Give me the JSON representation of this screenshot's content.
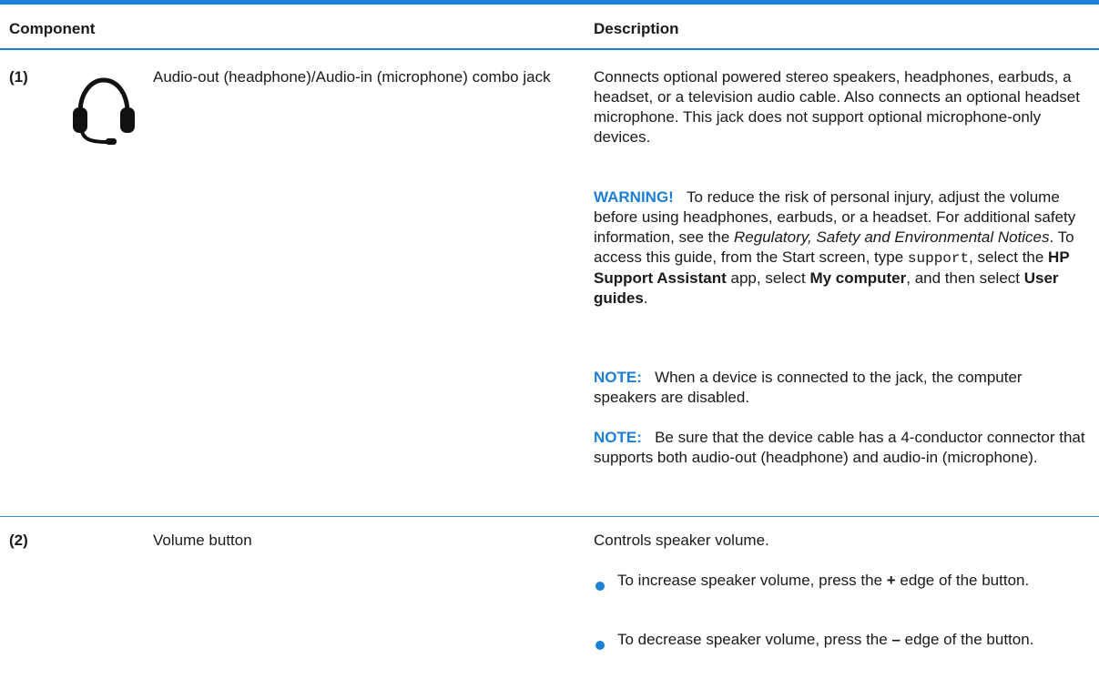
{
  "header": {
    "component": "Component",
    "description": "Description"
  },
  "rows": [
    {
      "number": "(1)",
      "icon": "headset-icon",
      "component": "Audio-out (headphone)/Audio-in (microphone) combo jack",
      "description": "Connects optional powered stereo speakers, headphones, earbuds, a headset, or a television audio cable. Also connects an optional headset microphone. This jack does not support optional microphone-only devices.",
      "warning": {
        "label": "WARNING!",
        "text1": "To reduce the risk of personal injury, adjust the volume before using headphones, earbuds, or a headset. For additional safety information, see the ",
        "doc_title": "Regulatory, Safety and Environmental Notices",
        "text2": ". To access this guide, from the Start screen, type ",
        "code": "support",
        "text3": ", select the ",
        "app": "HP Support Assistant",
        "text4": " app, select ",
        "my_computer": "My computer",
        "text5": ", and then select ",
        "user_guides": "User guides",
        "text6": "."
      },
      "note1": {
        "label": "NOTE:",
        "text": "When a device is connected to the jack, the computer speakers are disabled."
      },
      "note2": {
        "label": "NOTE:",
        "text": "Be sure that the device cable has a 4-conductor connector that supports both audio-out (headphone) and audio-in (microphone)."
      }
    },
    {
      "number": "(2)",
      "component": "Volume button",
      "description": "Controls speaker volume.",
      "bullets": [
        {
          "before": "To increase speaker volume, press the ",
          "symbol": "+",
          "after": " edge of the button."
        },
        {
          "before": "To decrease speaker volume, press the ",
          "symbol": "–",
          "after": " edge of the button."
        }
      ]
    }
  ],
  "colors": {
    "accent": "#1e7fd6",
    "text": "#1a1a1a"
  }
}
